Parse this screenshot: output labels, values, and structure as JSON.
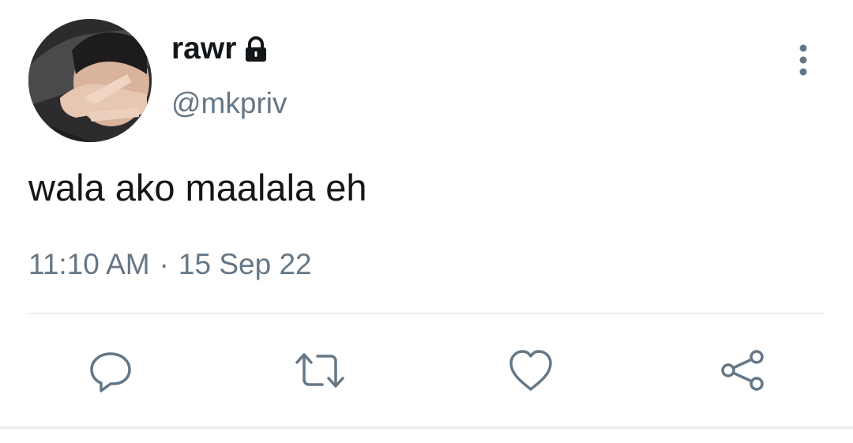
{
  "tweet": {
    "display_name": "rawr",
    "handle": "@mkpriv",
    "text": "wala ako maalala eh",
    "time": "11:10 AM",
    "separator": "·",
    "date": "15 Sep 22",
    "protected_icon": "lock-icon",
    "more_icon": "more-vertical-icon"
  },
  "actions": [
    {
      "name": "reply",
      "icon": "reply-icon"
    },
    {
      "name": "retweet",
      "icon": "retweet-icon"
    },
    {
      "name": "like",
      "icon": "heart-icon"
    },
    {
      "name": "share",
      "icon": "share-icon"
    }
  ],
  "colors": {
    "primary_text": "#14171a",
    "secondary_text": "#657786",
    "icon": "#657786",
    "divider": "#e6ecf0"
  }
}
